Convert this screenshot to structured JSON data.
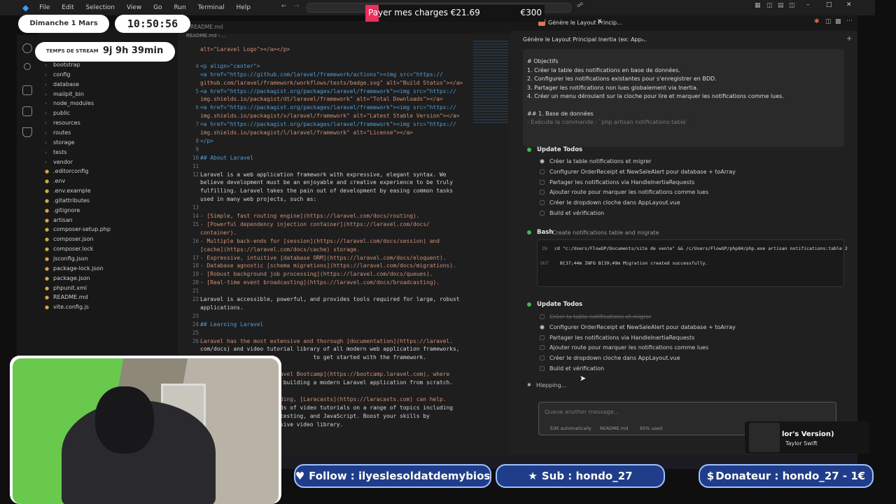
{
  "titlebar": {
    "menus": [
      "File",
      "Edit",
      "Selection",
      "View",
      "Go",
      "Run",
      "Terminal",
      "Help"
    ]
  },
  "editor_tabs": {
    "tab1": "README.md",
    "tab2": "README.md › ..."
  },
  "explorer": {
    "items": [
      {
        "label": "bootstrap",
        "type": "folder"
      },
      {
        "label": "config",
        "type": "folder"
      },
      {
        "label": "database",
        "type": "folder"
      },
      {
        "label": "mailpit_bin",
        "type": "folder"
      },
      {
        "label": "node_modules",
        "type": "folder"
      },
      {
        "label": "public",
        "type": "folder"
      },
      {
        "label": "resources",
        "type": "folder"
      },
      {
        "label": "routes",
        "type": "folder"
      },
      {
        "label": "storage",
        "type": "folder"
      },
      {
        "label": "tests",
        "type": "folder"
      },
      {
        "label": "vendor",
        "type": "folder"
      },
      {
        "label": ".editorconfig",
        "type": "file"
      },
      {
        "label": ".env",
        "type": "file"
      },
      {
        "label": ".env.example",
        "type": "file"
      },
      {
        "label": ".gitattributes",
        "type": "file"
      },
      {
        "label": ".gitignore",
        "type": "file"
      },
      {
        "label": "artisan",
        "type": "file"
      },
      {
        "label": "composer-setup.php",
        "type": "file"
      },
      {
        "label": "composer.json",
        "type": "file"
      },
      {
        "label": "composer.lock",
        "type": "file"
      },
      {
        "label": "jsconfig.json",
        "type": "file"
      },
      {
        "label": "package-lock.json",
        "type": "file"
      },
      {
        "label": "package.json",
        "type": "file"
      },
      {
        "label": "phpunit.xml",
        "type": "file"
      },
      {
        "label": "README.md",
        "type": "file"
      },
      {
        "label": "vite.config.js",
        "type": "file"
      }
    ]
  },
  "editor": {
    "lines": [
      {
        "n": "",
        "t": "alt=\"Laravel Logo\"></a></p>",
        "k": "c-str"
      },
      {
        "n": "",
        "t": "",
        "k": "c-text"
      },
      {
        "n": "4",
        "t": "<p align=\"center\">",
        "k": "c-tag"
      },
      {
        "n": "",
        "t": "<a href=\"https://github.com/laravel/framework/actions\"><img src=\"https://",
        "k": "c-tag"
      },
      {
        "n": "",
        "t": "github.com/laravel/framework/workflows/tests/badge.svg\" alt=\"Build Status\"></a>",
        "k": "c-str"
      },
      {
        "n": "5",
        "t": "<a href=\"https://packagist.org/packages/laravel/framework\"><img src=\"https://",
        "k": "c-tag"
      },
      {
        "n": "",
        "t": "img.shields.io/packagist/dt/laravel/framework\" alt=\"Total Downloads\"></a>",
        "k": "c-str"
      },
      {
        "n": "6",
        "t": "<a href=\"https://packagist.org/packages/laravel/framework\"><img src=\"https://",
        "k": "c-tag"
      },
      {
        "n": "",
        "t": "img.shields.io/packagist/v/laravel/framework\" alt=\"Latest Stable Version\"></a>",
        "k": "c-str"
      },
      {
        "n": "7",
        "t": "<a href=\"https://packagist.org/packages/laravel/framework\"><img src=\"https://",
        "k": "c-tag"
      },
      {
        "n": "",
        "t": "img.shields.io/packagist/l/laravel/framework\" alt=\"License\"></a>",
        "k": "c-str"
      },
      {
        "n": "8",
        "t": "</p>",
        "k": "c-tag"
      },
      {
        "n": "9",
        "t": "",
        "k": "c-text"
      },
      {
        "n": "10",
        "t": "## About Laravel",
        "k": "c-head"
      },
      {
        "n": "11",
        "t": "",
        "k": "c-text"
      },
      {
        "n": "12",
        "t": "Laravel is a web application framework with expressive, elegant syntax. We",
        "k": "c-text"
      },
      {
        "n": "",
        "t": "believe development must be an enjoyable and creative experience to be truly",
        "k": "c-text"
      },
      {
        "n": "",
        "t": "fulfilling. Laravel takes the pain out of development by easing common tasks",
        "k": "c-text"
      },
      {
        "n": "",
        "t": "used in many web projects, such as:",
        "k": "c-text"
      },
      {
        "n": "13",
        "t": "",
        "k": "c-text"
      },
      {
        "n": "14",
        "t": "- [Simple, fast routing engine](https://laravel.com/docs/routing).",
        "k": "c-link"
      },
      {
        "n": "15",
        "t": "- [Powerful dependency injection container](https://laravel.com/docs/",
        "k": "c-link"
      },
      {
        "n": "",
        "t": "container).",
        "k": "c-link"
      },
      {
        "n": "16",
        "t": "- Multiple back-ends for [session](https://laravel.com/docs/session) and",
        "k": "c-link"
      },
      {
        "n": "",
        "t": "[cache](https://laravel.com/docs/cache) storage.",
        "k": "c-link"
      },
      {
        "n": "17",
        "t": "- Expressive, intuitive [database ORM](https://laravel.com/docs/eloquent).",
        "k": "c-link"
      },
      {
        "n": "18",
        "t": "- Database agnostic [schema migrations](https://laravel.com/docs/migrations).",
        "k": "c-link"
      },
      {
        "n": "19",
        "t": "- [Robust background job processing](https://laravel.com/docs/queues).",
        "k": "c-link"
      },
      {
        "n": "20",
        "t": "- [Real-time event broadcasting](https://laravel.com/docs/broadcasting).",
        "k": "c-link"
      },
      {
        "n": "21",
        "t": "",
        "k": "c-text"
      },
      {
        "n": "22",
        "t": "Laravel is accessible, powerful, and provides tools required for large, robust",
        "k": "c-text"
      },
      {
        "n": "",
        "t": "applications.",
        "k": "c-text"
      },
      {
        "n": "23",
        "t": "",
        "k": "c-text"
      },
      {
        "n": "24",
        "t": "## Learning Laravel",
        "k": "c-head"
      },
      {
        "n": "25",
        "t": "",
        "k": "c-text"
      },
      {
        "n": "26",
        "t": "Laravel has the most extensive and thorough [documentation](https://laravel.",
        "k": "c-link"
      },
      {
        "n": "",
        "t": "com/docs) and video tutorial library of all modern web application frameworks,",
        "k": "c-text"
      },
      {
        "n": "",
        "t": "                                  to get started with the framework.",
        "k": "c-text"
      },
      {
        "n": "",
        "t": "",
        "k": "c-text"
      },
      {
        "n": "",
        "t": "                      aravel Bootcamp](https://bootcamp.laravel.com), where",
        "k": "c-link"
      },
      {
        "n": "",
        "t": "                      gh building a modern Laravel application from scratch.",
        "k": "c-text"
      },
      {
        "n": "",
        "t": "",
        "k": "c-text"
      },
      {
        "n": "",
        "t": "                      eading, [Laracasts](https://laracasts.com) can help.",
        "k": "c-link"
      },
      {
        "n": "",
        "t": "                      ands of video tutorials on a range of topics including",
        "k": "c-text"
      },
      {
        "n": "",
        "t": "                      t testing, and JavaScript. Boost your skills by",
        "k": "c-text"
      },
      {
        "n": "",
        "t": "                      ensive video library.",
        "k": "c-text"
      }
    ]
  },
  "chat": {
    "tab_title": "Génère le Layout Princip...",
    "header_title": "Génère le Layout Principal Inertia (ex: App...",
    "prompt": {
      "heading": "# Objectifs",
      "lines": [
        "1. Créer la table des notifications en base de données.",
        "2. Configurer les notifications existantes pour s'enregistrer en BDD.",
        "3. Partager les notifications non lues globalement via Inertia.",
        "4. Créer un menu déroulant sur la cloche pour lire et marquer les notifications comme lues."
      ],
      "sub": "## 1. Base de données",
      "sub_line": "- Exécute la commande : `php artisan notifications:table`"
    },
    "todos1": {
      "title": "Update Todos",
      "items": [
        "Créer la table notifications et migrer",
        "Configurer OrderReceipt et NewSaleAlert pour database + toArray",
        "Partager les notifications via HandleInertiaRequests",
        "Ajouter route pour marquer les notifications comme lues",
        "Créer le dropdown cloche dans AppLayout.vue",
        "Build et vérification"
      ]
    },
    "bash": {
      "title": "Bash",
      "desc": "Create notifications table and migrate",
      "in_label": "IN",
      "in_cmd": "cd \"c:/Users/FlowUP/Documents/site de vente\" && /c/Users/FlowUP/php84/php.exe artisan notifications:table 2",
      "out_label": "OUT",
      "out_text": "B[37;44m INFO B[39;49m Migration created successfully."
    },
    "todos2": {
      "title": "Update Todos",
      "items": [
        "Créer la table notifications et migrer",
        "Configurer OrderReceipt et NewSaleAlert pour database + toArray",
        "Partager les notifications via HandleInertiaRequests",
        "Ajouter route pour marquer les notifications comme lues",
        "Créer le dropdown cloche dans AppLayout.vue",
        "Build et vérification"
      ]
    },
    "status": "Hlepping...",
    "input_placeholder": "Queue another message...",
    "footer": {
      "edit": "Edit automatically",
      "file": "README.md",
      "usage": "95% used"
    }
  },
  "overlay": {
    "date": "Dimanche 1 Mars",
    "time": "10:50:56",
    "stream_label": "TEMPS DE STREAM",
    "stream_time": "9j 9h 39min",
    "goal_label": "Payer mes charges €21.69",
    "goal_target": "€300",
    "goal_progress": 0.0723,
    "music_title": "lor's Version)",
    "music_artist": "Taylor Swift",
    "follow": "Follow : ilyeslesoldatdemybios",
    "sub": "Sub : hondo_27",
    "donateur": "Donateur : hondo_27 - 1€"
  },
  "colors": {
    "accent": "#e8315b",
    "bar_blue": "#1f3d8a",
    "todo_dot": "#3fb950"
  }
}
